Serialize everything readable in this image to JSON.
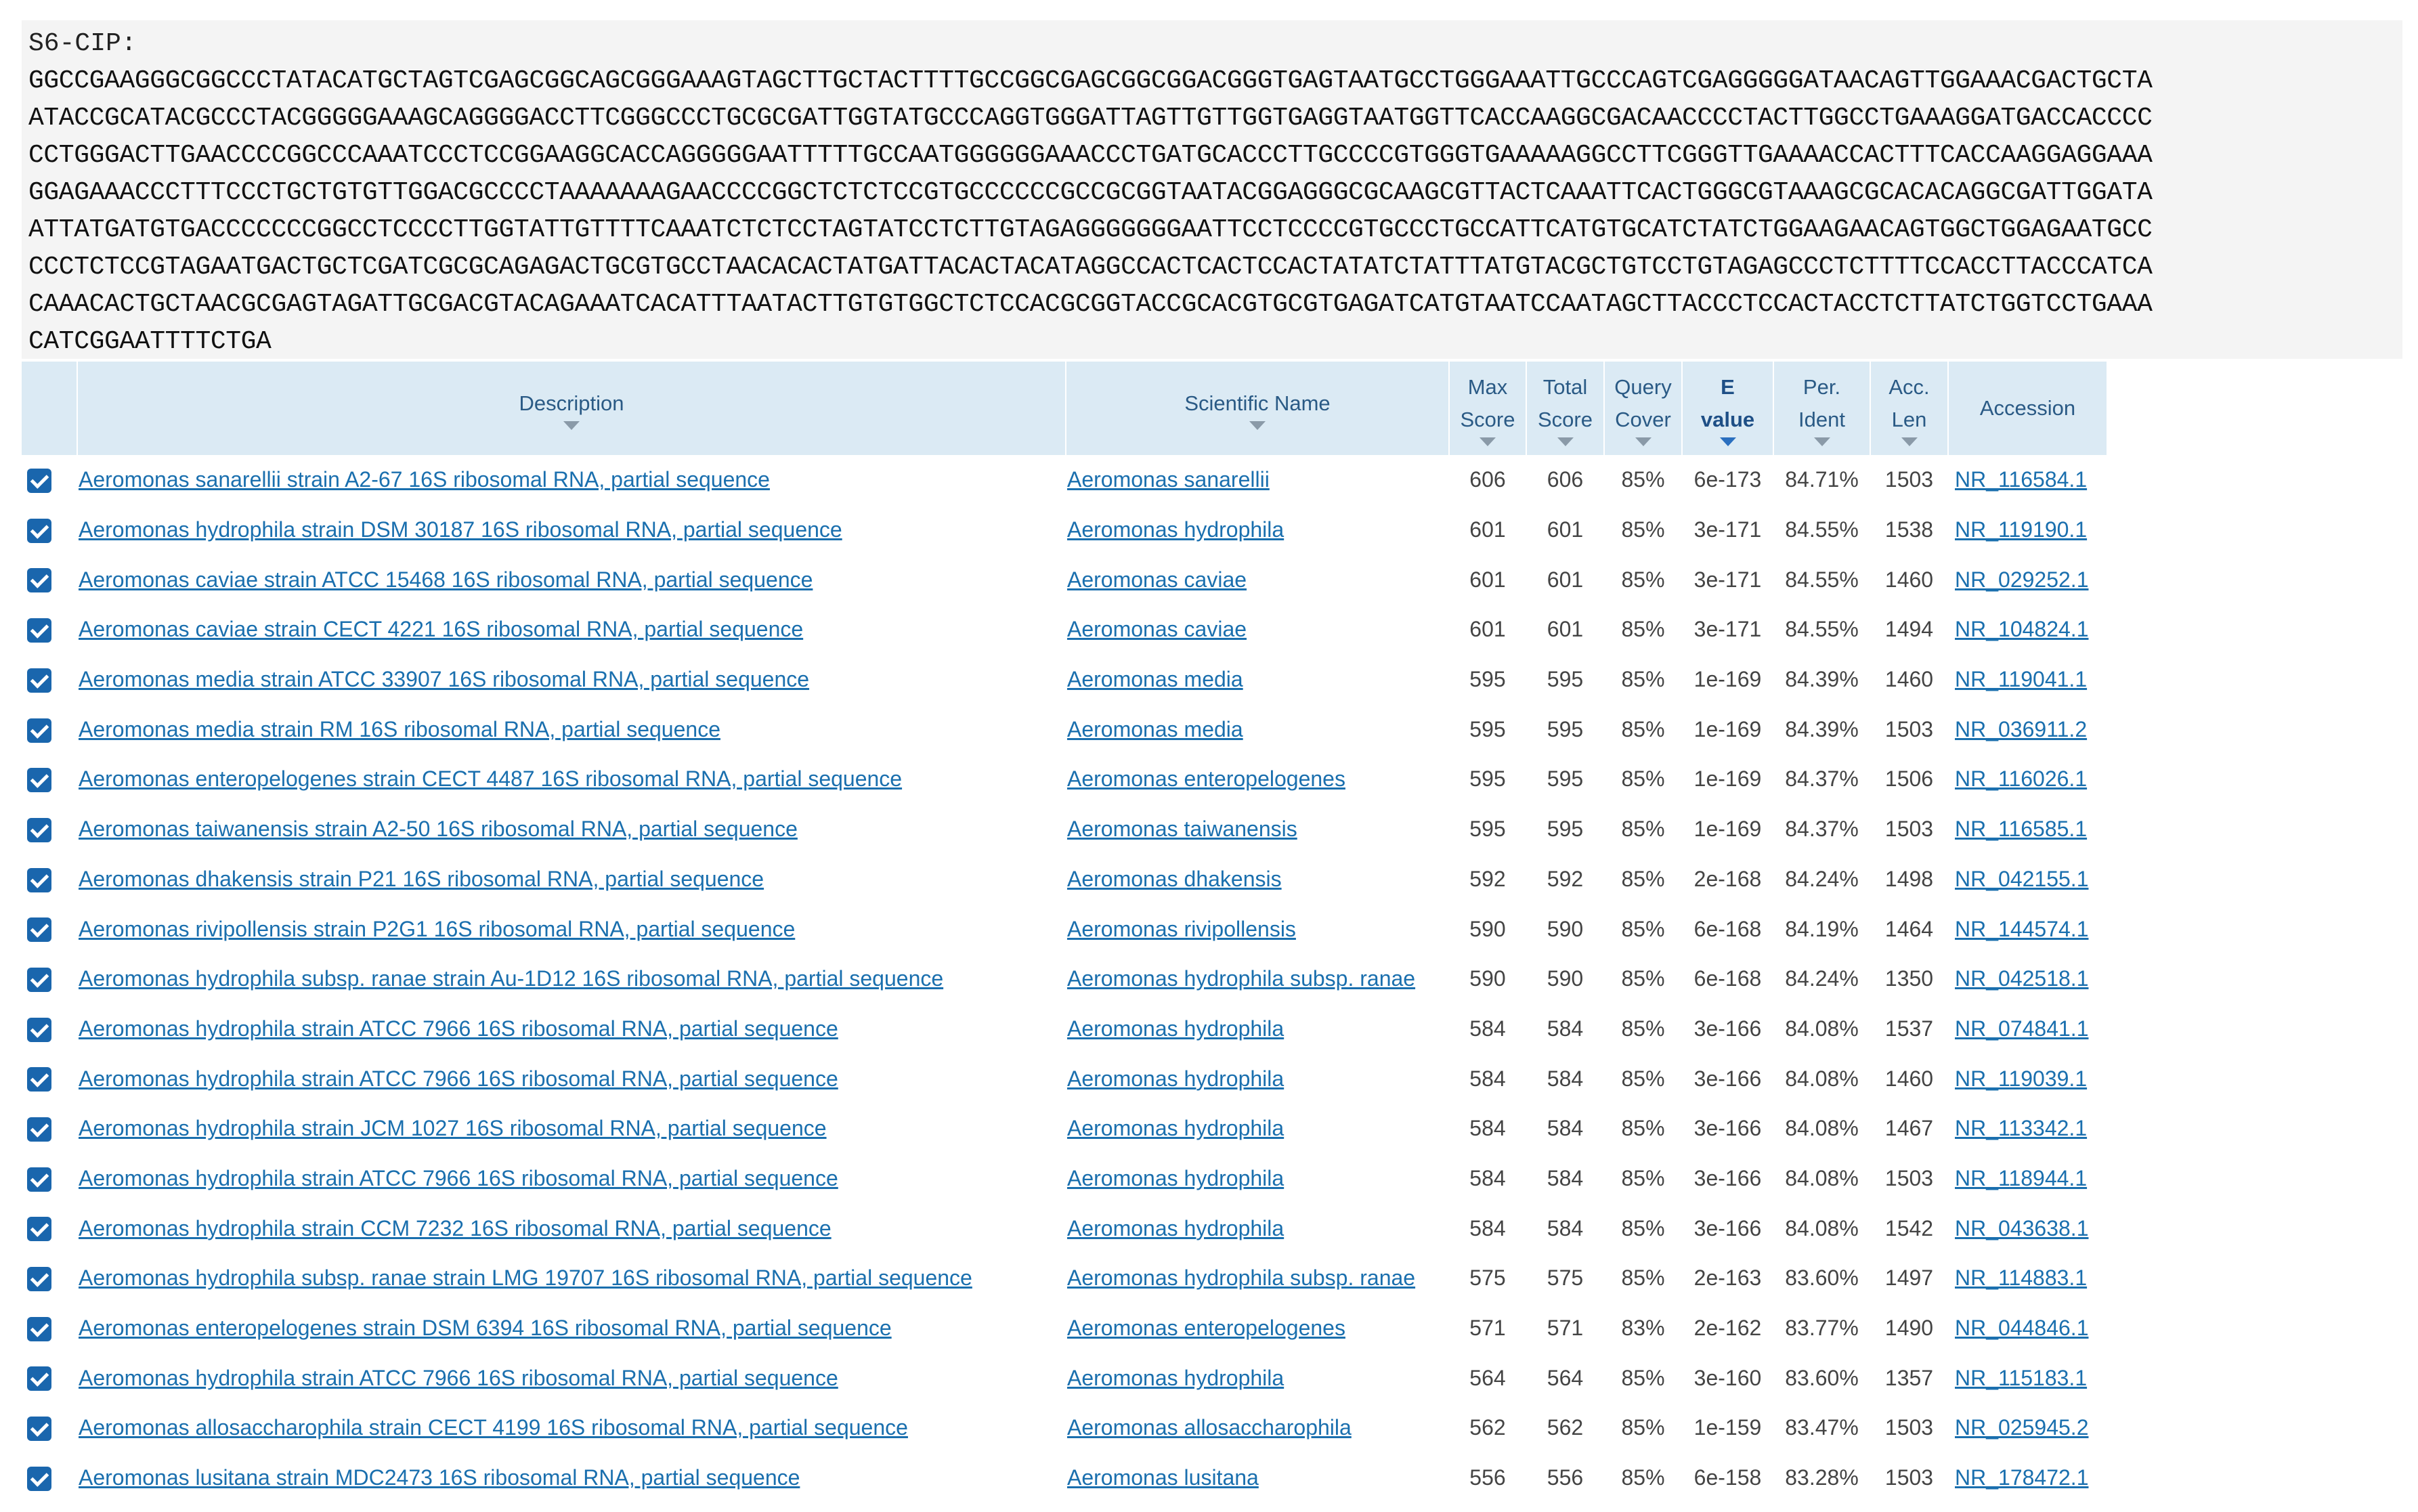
{
  "sequence": {
    "label": "S6-CIP:",
    "lines": [
      "GGCCGAAGGGCGGCCCTATACATGCTAGTCGAGCGGCAGCGGGAAAGTAGCTTGCTACTTTTGCCGGCGAGCGGCGGACGGGTGAGTAATGCCTGGGAAATTGCCCAGTCGAGGGGGATAACAGTTGGAAACGACTGCTA",
      "ATACCGCATACGCCCTACGGGGGAAAGCAGGGGACCTTCGGGCCCTGCGCGATTGGTATGCCCAGGTGGGATTAGTTGTTGGTGAGGTAATGGTTCACCAAGGCGACAACCCCTACTTGGCCTGAAAGGATGACCACCCC",
      "CCTGGGACTTGAACCCCGGCCCAAATCCCTCCGGAAGGCACCAGGGGGAATTTTTGCCAATGGGGGGAAACCCTGATGCACCCTTGCCCCGTGGGTGAAAAAGGCCTTCGGGTTGAAAACCACTTTCACCAAGGAGGAAA",
      "GGAGAAACCCTTTCCCTGCTGTGTTGGACGCCCCTAAAAAAAGAACCCCGGCTCTCTCCGTGCCCCCCGCCGCGGTAATACGGAGGGCGCAAGCGTTACTCAAATTCACTGGGCGTAAAGCGCACACAGGCGATTGGATA",
      "ATTATGATGTGACCCCCCCGGCCTCCCCTTGGTATTGTTTTCAAATCTCTCCTAGTATCCTCTTGTAGAGGGGGGGAATTCCTCCCCGTGCCCTGCCATTCATGTGCATCTATCTGGAAGAACAGTGGCTGGAGAATGCC",
      "CCCTCTCCGTAGAATGACTGCTCGATCGCGCAGAGACTGCGTGCCTAACACACTATGATTACACTACATAGGCCACTCACTCCACTATATCTATTTATGTACGCTGTCCTGTAGAGCCCTCTTTTCCACCTTACCCATCA",
      "CAAACACTGCTAACGCGAGTAGATTGCGACGTACAGAAATCACATTTAATACTTGTGTGGCTCTCCACGCGGTACCGCACGTGCGTGAGATCATGTAATCCAATAGCTTACCCTCCACTACCTCTTATCTGGTCCTGAAA",
      "CATCGGAATTTTCTGA"
    ]
  },
  "table": {
    "headers": {
      "description": "Description",
      "scientific_name": "Scientific Name",
      "max_score_1": "Max",
      "max_score_2": "Score",
      "total_score_1": "Total",
      "total_score_2": "Score",
      "query_cover_1": "Query",
      "query_cover_2": "Cover",
      "e_value_1": "E",
      "e_value_2": "value",
      "per_ident_1": "Per.",
      "per_ident_2": "Ident",
      "acc_len_1": "Acc.",
      "acc_len_2": "Len",
      "accession": "Accession"
    },
    "rows": [
      {
        "description": "Aeromonas sanarellii strain A2-67 16S ribosomal RNA, partial sequence",
        "scientific_name": "Aeromonas sanarellii",
        "max_score": "606",
        "total_score": "606",
        "query_cover": "85%",
        "e_value": "6e-173",
        "per_ident": "84.71%",
        "acc_len": "1503",
        "accession": "NR_116584.1"
      },
      {
        "description": "Aeromonas hydrophila strain DSM 30187 16S ribosomal RNA, partial sequence",
        "scientific_name": "Aeromonas hydrophila",
        "max_score": "601",
        "total_score": "601",
        "query_cover": "85%",
        "e_value": "3e-171",
        "per_ident": "84.55%",
        "acc_len": "1538",
        "accession": "NR_119190.1"
      },
      {
        "description": "Aeromonas caviae strain ATCC 15468 16S ribosomal RNA, partial sequence",
        "scientific_name": "Aeromonas caviae",
        "max_score": "601",
        "total_score": "601",
        "query_cover": "85%",
        "e_value": "3e-171",
        "per_ident": "84.55%",
        "acc_len": "1460",
        "accession": "NR_029252.1"
      },
      {
        "description": "Aeromonas caviae strain CECT 4221 16S ribosomal RNA, partial sequence",
        "scientific_name": "Aeromonas caviae",
        "max_score": "601",
        "total_score": "601",
        "query_cover": "85%",
        "e_value": "3e-171",
        "per_ident": "84.55%",
        "acc_len": "1494",
        "accession": "NR_104824.1"
      },
      {
        "description": "Aeromonas media strain ATCC 33907 16S ribosomal RNA, partial sequence",
        "scientific_name": "Aeromonas media",
        "max_score": "595",
        "total_score": "595",
        "query_cover": "85%",
        "e_value": "1e-169",
        "per_ident": "84.39%",
        "acc_len": "1460",
        "accession": "NR_119041.1"
      },
      {
        "description": "Aeromonas media strain RM 16S ribosomal RNA, partial sequence",
        "scientific_name": "Aeromonas media",
        "max_score": "595",
        "total_score": "595",
        "query_cover": "85%",
        "e_value": "1e-169",
        "per_ident": "84.39%",
        "acc_len": "1503",
        "accession": "NR_036911.2"
      },
      {
        "description": "Aeromonas enteropelogenes strain CECT 4487 16S ribosomal RNA, partial sequence",
        "scientific_name": "Aeromonas enteropelogenes",
        "max_score": "595",
        "total_score": "595",
        "query_cover": "85%",
        "e_value": "1e-169",
        "per_ident": "84.37%",
        "acc_len": "1506",
        "accession": "NR_116026.1"
      },
      {
        "description": "Aeromonas taiwanensis strain A2-50 16S ribosomal RNA, partial sequence",
        "scientific_name": "Aeromonas taiwanensis",
        "max_score": "595",
        "total_score": "595",
        "query_cover": "85%",
        "e_value": "1e-169",
        "per_ident": "84.37%",
        "acc_len": "1503",
        "accession": "NR_116585.1"
      },
      {
        "description": "Aeromonas dhakensis strain P21 16S ribosomal RNA, partial sequence",
        "scientific_name": "Aeromonas dhakensis",
        "max_score": "592",
        "total_score": "592",
        "query_cover": "85%",
        "e_value": "2e-168",
        "per_ident": "84.24%",
        "acc_len": "1498",
        "accession": "NR_042155.1"
      },
      {
        "description": "Aeromonas rivipollensis strain P2G1 16S ribosomal RNA, partial sequence",
        "scientific_name": "Aeromonas rivipollensis",
        "max_score": "590",
        "total_score": "590",
        "query_cover": "85%",
        "e_value": "6e-168",
        "per_ident": "84.19%",
        "acc_len": "1464",
        "accession": "NR_144574.1"
      },
      {
        "description": "Aeromonas hydrophila subsp. ranae strain Au-1D12 16S ribosomal RNA, partial sequence",
        "scientific_name": "Aeromonas hydrophila subsp. ranae",
        "max_score": "590",
        "total_score": "590",
        "query_cover": "85%",
        "e_value": "6e-168",
        "per_ident": "84.24%",
        "acc_len": "1350",
        "accession": "NR_042518.1"
      },
      {
        "description": "Aeromonas hydrophila strain ATCC 7966 16S ribosomal RNA, partial sequence",
        "scientific_name": "Aeromonas hydrophila",
        "max_score": "584",
        "total_score": "584",
        "query_cover": "85%",
        "e_value": "3e-166",
        "per_ident": "84.08%",
        "acc_len": "1537",
        "accession": "NR_074841.1"
      },
      {
        "description": "Aeromonas hydrophila strain ATCC 7966 16S ribosomal RNA, partial sequence",
        "scientific_name": "Aeromonas hydrophila",
        "max_score": "584",
        "total_score": "584",
        "query_cover": "85%",
        "e_value": "3e-166",
        "per_ident": "84.08%",
        "acc_len": "1460",
        "accession": "NR_119039.1"
      },
      {
        "description": "Aeromonas hydrophila strain JCM 1027 16S ribosomal RNA, partial sequence",
        "scientific_name": "Aeromonas hydrophila",
        "max_score": "584",
        "total_score": "584",
        "query_cover": "85%",
        "e_value": "3e-166",
        "per_ident": "84.08%",
        "acc_len": "1467",
        "accession": "NR_113342.1"
      },
      {
        "description": "Aeromonas hydrophila strain ATCC 7966 16S ribosomal RNA, partial sequence",
        "scientific_name": "Aeromonas hydrophila",
        "max_score": "584",
        "total_score": "584",
        "query_cover": "85%",
        "e_value": "3e-166",
        "per_ident": "84.08%",
        "acc_len": "1503",
        "accession": "NR_118944.1"
      },
      {
        "description": "Aeromonas hydrophila strain CCM 7232 16S ribosomal RNA, partial sequence",
        "scientific_name": "Aeromonas hydrophila",
        "max_score": "584",
        "total_score": "584",
        "query_cover": "85%",
        "e_value": "3e-166",
        "per_ident": "84.08%",
        "acc_len": "1542",
        "accession": "NR_043638.1"
      },
      {
        "description": "Aeromonas hydrophila subsp. ranae strain LMG 19707 16S ribosomal RNA, partial sequence",
        "scientific_name": "Aeromonas hydrophila subsp. ranae",
        "max_score": "575",
        "total_score": "575",
        "query_cover": "85%",
        "e_value": "2e-163",
        "per_ident": "83.60%",
        "acc_len": "1497",
        "accession": "NR_114883.1"
      },
      {
        "description": "Aeromonas enteropelogenes strain DSM 6394 16S ribosomal RNA, partial sequence",
        "scientific_name": "Aeromonas enteropelogenes",
        "max_score": "571",
        "total_score": "571",
        "query_cover": "83%",
        "e_value": "2e-162",
        "per_ident": "83.77%",
        "acc_len": "1490",
        "accession": "NR_044846.1"
      },
      {
        "description": "Aeromonas hydrophila strain ATCC 7966 16S ribosomal RNA, partial sequence",
        "scientific_name": "Aeromonas hydrophila",
        "max_score": "564",
        "total_score": "564",
        "query_cover": "85%",
        "e_value": "3e-160",
        "per_ident": "83.60%",
        "acc_len": "1357",
        "accession": "NR_115183.1"
      },
      {
        "description": "Aeromonas allosaccharophila strain CECT 4199 16S ribosomal RNA, partial sequence",
        "scientific_name": "Aeromonas allosaccharophila",
        "max_score": "562",
        "total_score": "562",
        "query_cover": "85%",
        "e_value": "1e-159",
        "per_ident": "83.47%",
        "acc_len": "1503",
        "accession": "NR_025945.2"
      },
      {
        "description": "Aeromonas lusitana strain MDC2473 16S ribosomal RNA, partial sequence",
        "scientific_name": "Aeromonas lusitana",
        "max_score": "556",
        "total_score": "556",
        "query_cover": "85%",
        "e_value": "6e-158",
        "per_ident": "83.28%",
        "acc_len": "1503",
        "accession": "NR_178472.1"
      }
    ]
  },
  "colors": {
    "header_bg": "#dbeaf4",
    "link": "#1a6fae",
    "checkbox": "#1a66ad",
    "sequence_bg": "#f4f4f4"
  }
}
